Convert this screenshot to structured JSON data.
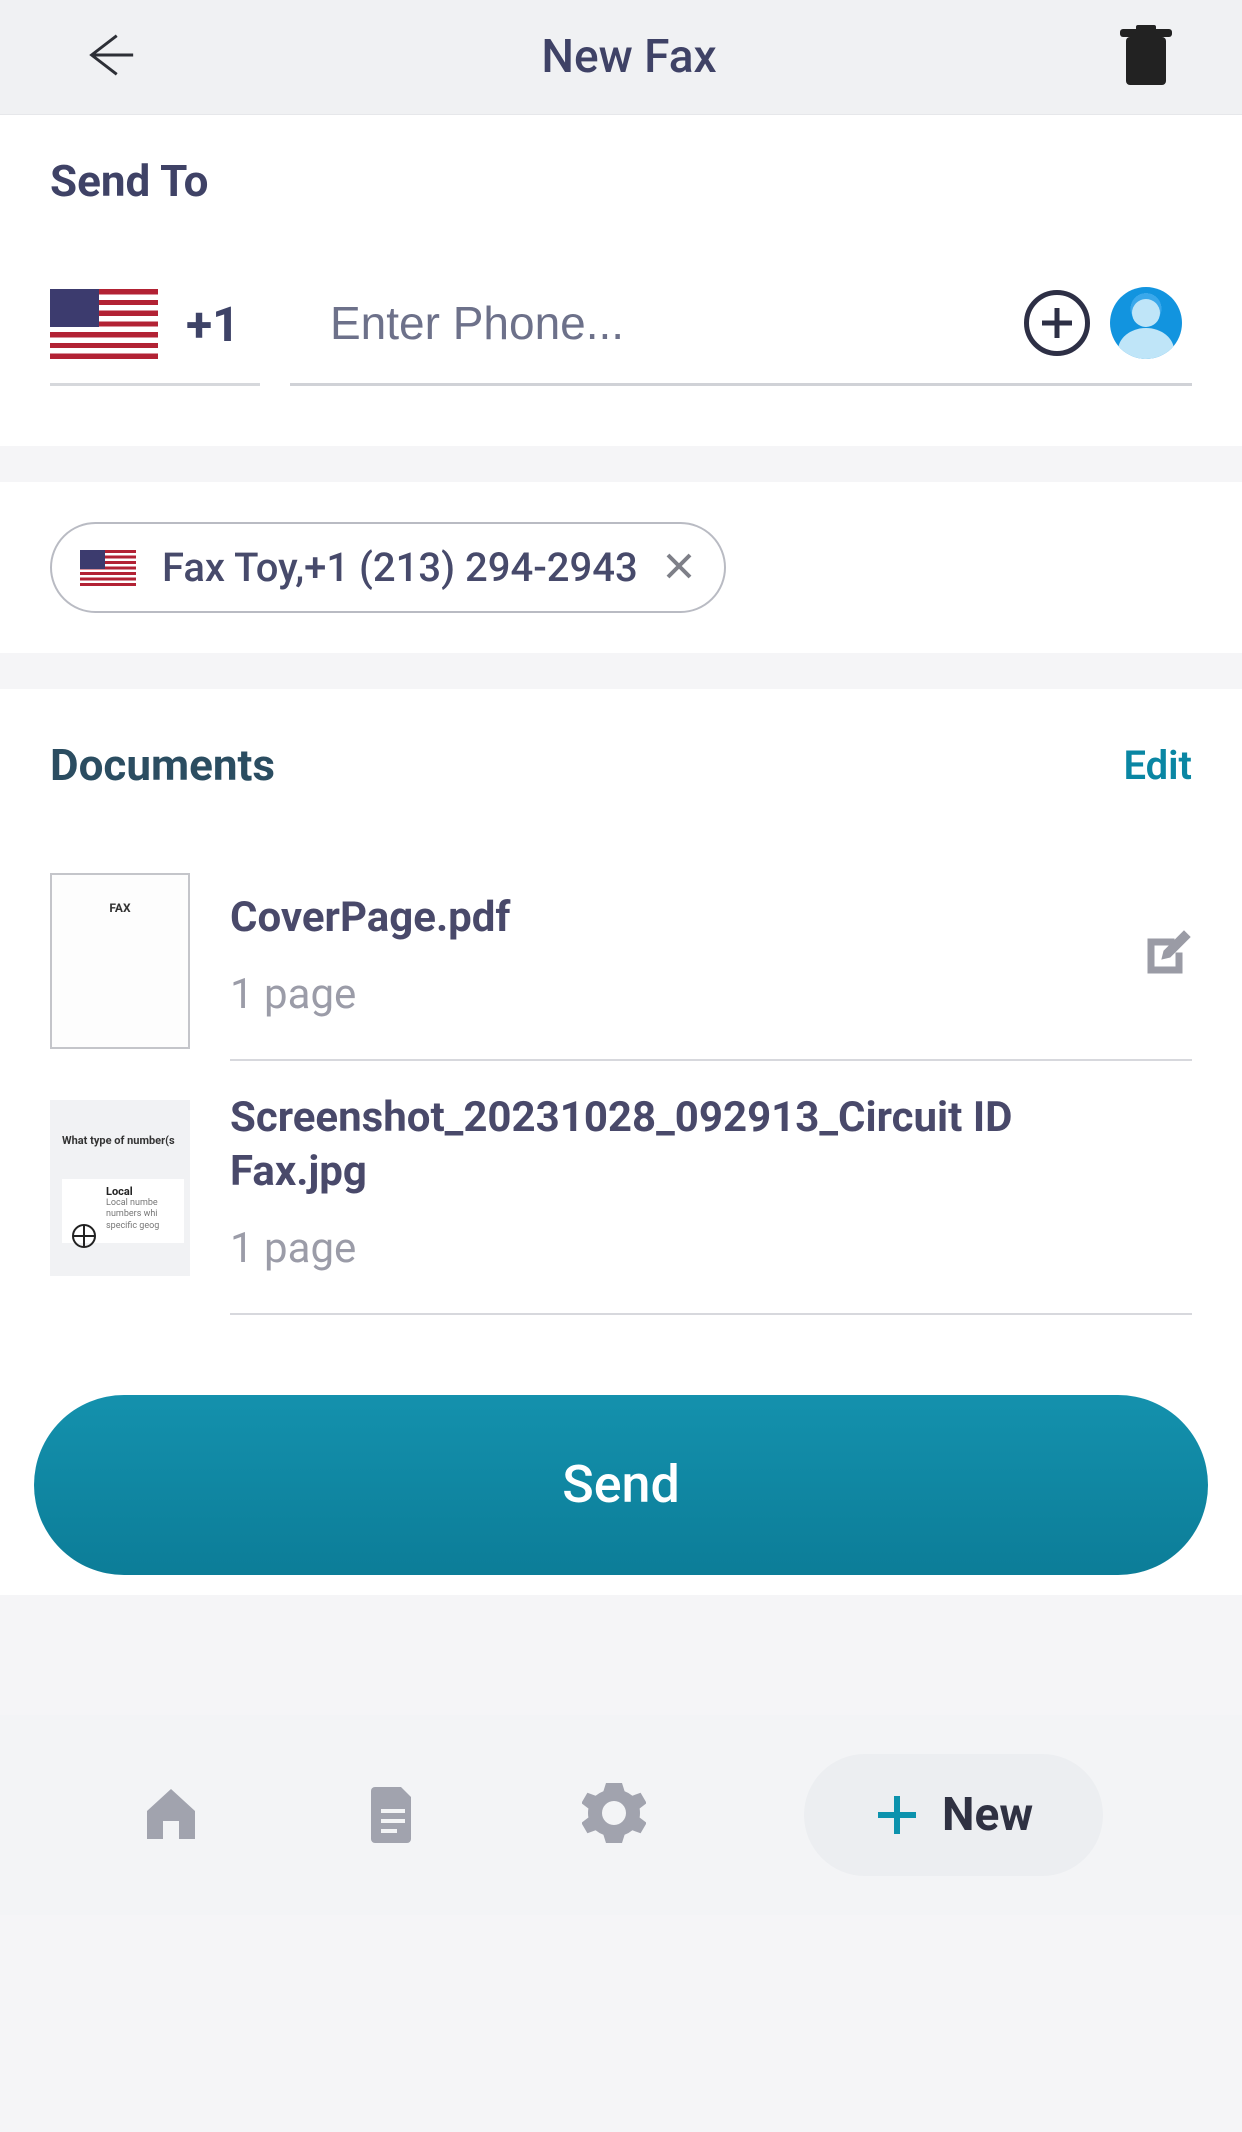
{
  "header": {
    "title": "New Fax"
  },
  "sendTo": {
    "label": "Send To",
    "countryCode": "+1",
    "phonePlaceholder": "Enter Phone..."
  },
  "recipient": {
    "chipText": "Fax Toy,+1 (213) 294-2943"
  },
  "documents": {
    "label": "Documents",
    "editLabel": "Edit",
    "items": [
      {
        "name": "CoverPage.pdf",
        "pages": "1 page"
      },
      {
        "name": "Screenshot_20231028_092913_Circuit ID Fax.jpg",
        "pages": "1 page"
      }
    ]
  },
  "actions": {
    "send": "Send"
  },
  "bottomNav": {
    "new": "New"
  }
}
